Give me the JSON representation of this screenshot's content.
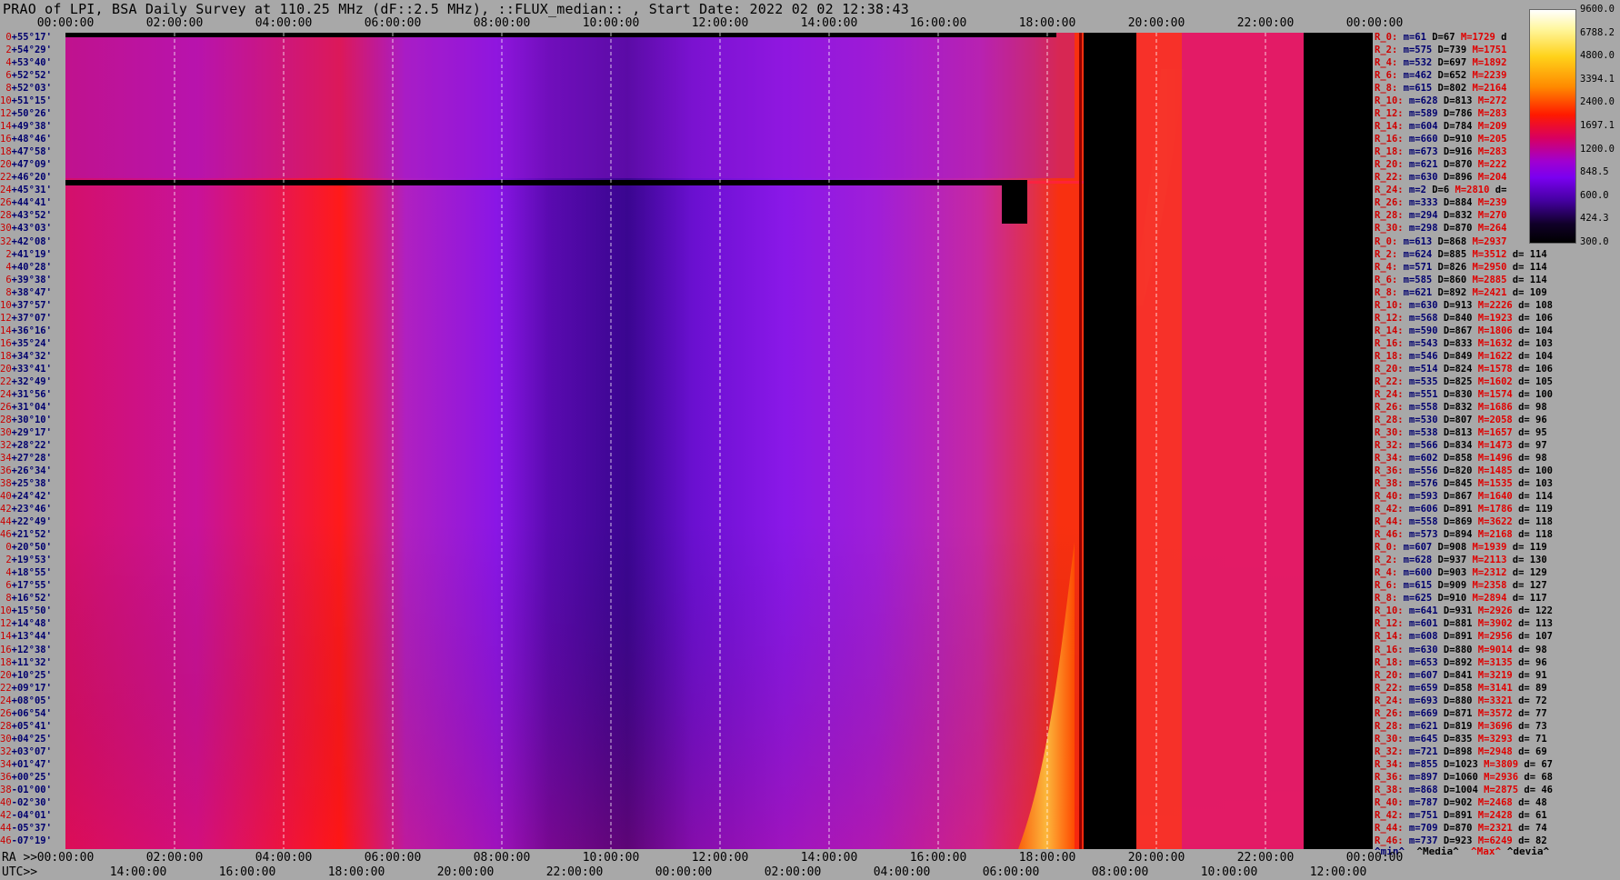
{
  "title": "PRAO of LPI, BSA Daily Survey at 110.25 MHz (dF::2.5 MHz), ::FLUX_median:: , Start Date: 2022 02 02 12:38:43",
  "top_axis_label": "",
  "bottom_axis": {
    "ra_label": "RA >>",
    "utc_label": "UTC>>",
    "ra_ticks": [
      "00:00:00",
      "02:00:00",
      "04:00:00",
      "06:00:00",
      "08:00:00",
      "10:00:00",
      "12:00:00",
      "14:00:00",
      "16:00:00",
      "18:00:00",
      "20:00:00",
      "22:00:00",
      "00:00:00"
    ],
    "utc_ticks": [
      "14:00:00",
      "16:00:00",
      "18:00:00",
      "20:00:00",
      "22:00:00",
      "00:00:00",
      "02:00:00",
      "04:00:00",
      "06:00:00",
      "08:00:00",
      "10:00:00",
      "12:00:00"
    ]
  },
  "colorbar": {
    "labels": [
      "9600.0",
      "6788.2",
      "4800.0",
      "3394.1",
      "2400.0",
      "1697.1",
      "1200.0",
      "848.5",
      "600.0",
      "424.3",
      "300.0"
    ]
  },
  "stats_legend": {
    "min": "^min^",
    "median": "^Media^",
    "max": "^Max^",
    "devia": "^devia^"
  },
  "chart_data": {
    "type": "heatmap",
    "title": "PRAO of LPI, BSA Daily Survey at 110.25 MHz (dF::2.5 MHz), ::FLUX_median:: , Start Date: 2022 02 02 12:38:43",
    "x_ticks_top": [
      "00:00:00",
      "02:00:00",
      "04:00:00",
      "06:00:00",
      "08:00:00",
      "10:00:00",
      "12:00:00",
      "14:00:00",
      "16:00:00",
      "18:00:00",
      "20:00:00",
      "22:00:00",
      "00:00:00"
    ],
    "xlim_hours": [
      0,
      24
    ],
    "colorbar_range": [
      300,
      9600
    ],
    "colorbar_scale": "log",
    "dec_rows": [
      {
        "n": "0",
        "dec": "+55°17'"
      },
      {
        "n": "2",
        "dec": "+54°29'"
      },
      {
        "n": "4",
        "dec": "+53°40'"
      },
      {
        "n": "6",
        "dec": "+52°52'"
      },
      {
        "n": "8",
        "dec": "+52°03'"
      },
      {
        "n": "10",
        "dec": "+51°15'"
      },
      {
        "n": "12",
        "dec": "+50°26'"
      },
      {
        "n": "14",
        "dec": "+49°38'"
      },
      {
        "n": "16",
        "dec": "+48°46'"
      },
      {
        "n": "18",
        "dec": "+47°58'"
      },
      {
        "n": "20",
        "dec": "+47°09'"
      },
      {
        "n": "22",
        "dec": "+46°20'"
      },
      {
        "n": "24",
        "dec": "+45°31'"
      },
      {
        "n": "26",
        "dec": "+44°41'"
      },
      {
        "n": "28",
        "dec": "+43°52'"
      },
      {
        "n": "30",
        "dec": "+43°03'"
      },
      {
        "n": "32",
        "dec": "+42°08'"
      },
      {
        "n": "2",
        "dec": "+41°19'"
      },
      {
        "n": "4",
        "dec": "+40°28'"
      },
      {
        "n": "6",
        "dec": "+39°38'"
      },
      {
        "n": "8",
        "dec": "+38°47'"
      },
      {
        "n": "10",
        "dec": "+37°57'"
      },
      {
        "n": "12",
        "dec": "+37°07'"
      },
      {
        "n": "14",
        "dec": "+36°16'"
      },
      {
        "n": "16",
        "dec": "+35°24'"
      },
      {
        "n": "18",
        "dec": "+34°32'"
      },
      {
        "n": "20",
        "dec": "+33°41'"
      },
      {
        "n": "22",
        "dec": "+32°49'"
      },
      {
        "n": "24",
        "dec": "+31°56'"
      },
      {
        "n": "26",
        "dec": "+31°04'"
      },
      {
        "n": "28",
        "dec": "+30°10'"
      },
      {
        "n": "30",
        "dec": "+29°17'"
      },
      {
        "n": "32",
        "dec": "+28°22'"
      },
      {
        "n": "34",
        "dec": "+27°28'"
      },
      {
        "n": "36",
        "dec": "+26°34'"
      },
      {
        "n": "38",
        "dec": "+25°38'"
      },
      {
        "n": "40",
        "dec": "+24°42'"
      },
      {
        "n": "42",
        "dec": "+23°46'"
      },
      {
        "n": "44",
        "dec": "+22°49'"
      },
      {
        "n": "46",
        "dec": "+21°52'"
      },
      {
        "n": "0",
        "dec": "+20°50'"
      },
      {
        "n": "2",
        "dec": "+19°53'"
      },
      {
        "n": "4",
        "dec": "+18°55'"
      },
      {
        "n": "6",
        "dec": "+17°55'"
      },
      {
        "n": "8",
        "dec": "+16°52'"
      },
      {
        "n": "10",
        "dec": "+15°50'"
      },
      {
        "n": "12",
        "dec": "+14°48'"
      },
      {
        "n": "14",
        "dec": "+13°44'"
      },
      {
        "n": "16",
        "dec": "+12°38'"
      },
      {
        "n": "18",
        "dec": "+11°32'"
      },
      {
        "n": "20",
        "dec": "+10°25'"
      },
      {
        "n": "22",
        "dec": "+09°17'"
      },
      {
        "n": "24",
        "dec": "+08°05'"
      },
      {
        "n": "26",
        "dec": "+06°54'"
      },
      {
        "n": "28",
        "dec": "+05°41'"
      },
      {
        "n": "30",
        "dec": "+04°25'"
      },
      {
        "n": "32",
        "dec": "+03°07'"
      },
      {
        "n": "34",
        "dec": "+01°47'"
      },
      {
        "n": "36",
        "dec": "+00°25'"
      },
      {
        "n": "38",
        "dec": "-01°00'"
      },
      {
        "n": "40",
        "dec": "-02°30'"
      },
      {
        "n": "42",
        "dec": "-04°01'"
      },
      {
        "n": "44",
        "dec": "-05°37'"
      },
      {
        "n": "46",
        "dec": "-07°19'"
      }
    ],
    "stats_rows": [
      {
        "r": "R_0:",
        "min": "m=61",
        "med": "D=67",
        "max": "M=1729",
        "dev": "d"
      },
      {
        "r": "R_2:",
        "min": "m=575",
        "med": "D=739",
        "max": "M=1751",
        "dev": ""
      },
      {
        "r": "R_4:",
        "min": "m=532",
        "med": "D=697",
        "max": "M=1892",
        "dev": ""
      },
      {
        "r": "R_6:",
        "min": "m=462",
        "med": "D=652",
        "max": "M=2239",
        "dev": ""
      },
      {
        "r": "R_8:",
        "min": "m=615",
        "med": "D=802",
        "max": "M=2164",
        "dev": ""
      },
      {
        "r": "R_10:",
        "min": "m=628",
        "med": "D=813",
        "max": "M=272",
        "dev": ""
      },
      {
        "r": "R_12:",
        "min": "m=589",
        "med": "D=786",
        "max": "M=283",
        "dev": ""
      },
      {
        "r": "R_14:",
        "min": "m=604",
        "med": "D=784",
        "max": "M=209",
        "dev": ""
      },
      {
        "r": "R_16:",
        "min": "m=660",
        "med": "D=910",
        "max": "M=205",
        "dev": ""
      },
      {
        "r": "R_18:",
        "min": "m=673",
        "med": "D=916",
        "max": "M=283",
        "dev": ""
      },
      {
        "r": "R_20:",
        "min": "m=621",
        "med": "D=870",
        "max": "M=222",
        "dev": ""
      },
      {
        "r": "R_22:",
        "min": "m=630",
        "med": "D=896",
        "max": "M=204",
        "dev": ""
      },
      {
        "r": "R_24:",
        "min": "m=2",
        "med": "D=6",
        "max": "M=2810",
        "dev": "d="
      },
      {
        "r": "R_26:",
        "min": "m=333",
        "med": "D=884",
        "max": "M=239",
        "dev": ""
      },
      {
        "r": "R_28:",
        "min": "m=294",
        "med": "D=832",
        "max": "M=270",
        "dev": ""
      },
      {
        "r": "R_30:",
        "min": "m=298",
        "med": "D=870",
        "max": "M=264",
        "dev": ""
      },
      {
        "r": "R_0:",
        "min": "m=613",
        "med": "D=868",
        "max": "M=2937",
        "dev": ""
      },
      {
        "r": "R_2:",
        "min": "m=624",
        "med": "D=885",
        "max": "M=3512",
        "dev": "d= 114"
      },
      {
        "r": "R_4:",
        "min": "m=571",
        "med": "D=826",
        "max": "M=2950",
        "dev": "d= 114"
      },
      {
        "r": "R_6:",
        "min": "m=585",
        "med": "D=860",
        "max": "M=2885",
        "dev": "d= 114"
      },
      {
        "r": "R_8:",
        "min": "m=621",
        "med": "D=892",
        "max": "M=2421",
        "dev": "d= 109"
      },
      {
        "r": "R_10:",
        "min": "m=630",
        "med": "D=913",
        "max": "M=2226",
        "dev": "d= 108"
      },
      {
        "r": "R_12:",
        "min": "m=568",
        "med": "D=840",
        "max": "M=1923",
        "dev": "d= 106"
      },
      {
        "r": "R_14:",
        "min": "m=590",
        "med": "D=867",
        "max": "M=1806",
        "dev": "d= 104"
      },
      {
        "r": "R_16:",
        "min": "m=543",
        "med": "D=833",
        "max": "M=1632",
        "dev": "d= 103"
      },
      {
        "r": "R_18:",
        "min": "m=546",
        "med": "D=849",
        "max": "M=1622",
        "dev": "d= 104"
      },
      {
        "r": "R_20:",
        "min": "m=514",
        "med": "D=824",
        "max": "M=1578",
        "dev": "d= 106"
      },
      {
        "r": "R_22:",
        "min": "m=535",
        "med": "D=825",
        "max": "M=1602",
        "dev": "d= 105"
      },
      {
        "r": "R_24:",
        "min": "m=551",
        "med": "D=830",
        "max": "M=1574",
        "dev": "d= 100"
      },
      {
        "r": "R_26:",
        "min": "m=558",
        "med": "D=832",
        "max": "M=1686",
        "dev": "d= 98"
      },
      {
        "r": "R_28:",
        "min": "m=530",
        "med": "D=807",
        "max": "M=2058",
        "dev": "d= 96"
      },
      {
        "r": "R_30:",
        "min": "m=538",
        "med": "D=813",
        "max": "M=1657",
        "dev": "d= 95"
      },
      {
        "r": "R_32:",
        "min": "m=566",
        "med": "D=834",
        "max": "M=1473",
        "dev": "d= 97"
      },
      {
        "r": "R_34:",
        "min": "m=602",
        "med": "D=858",
        "max": "M=1496",
        "dev": "d= 98"
      },
      {
        "r": "R_36:",
        "min": "m=556",
        "med": "D=820",
        "max": "M=1485",
        "dev": "d= 100"
      },
      {
        "r": "R_38:",
        "min": "m=576",
        "med": "D=845",
        "max": "M=1535",
        "dev": "d= 103"
      },
      {
        "r": "R_40:",
        "min": "m=593",
        "med": "D=867",
        "max": "M=1640",
        "dev": "d= 114"
      },
      {
        "r": "R_42:",
        "min": "m=606",
        "med": "D=891",
        "max": "M=1786",
        "dev": "d= 119"
      },
      {
        "r": "R_44:",
        "min": "m=558",
        "med": "D=869",
        "max": "M=3622",
        "dev": "d= 118"
      },
      {
        "r": "R_46:",
        "min": "m=573",
        "med": "D=894",
        "max": "M=2168",
        "dev": "d= 118"
      },
      {
        "r": "R_0:",
        "min": "m=607",
        "med": "D=908",
        "max": "M=1939",
        "dev": "d= 119"
      },
      {
        "r": "R_2:",
        "min": "m=628",
        "med": "D=937",
        "max": "M=2113",
        "dev": "d= 130"
      },
      {
        "r": "R_4:",
        "min": "m=600",
        "med": "D=903",
        "max": "M=2312",
        "dev": "d= 129"
      },
      {
        "r": "R_6:",
        "min": "m=615",
        "med": "D=909",
        "max": "M=2358",
        "dev": "d= 127"
      },
      {
        "r": "R_8:",
        "min": "m=625",
        "med": "D=910",
        "max": "M=2894",
        "dev": "d= 117"
      },
      {
        "r": "R_10:",
        "min": "m=641",
        "med": "D=931",
        "max": "M=2926",
        "dev": "d= 122"
      },
      {
        "r": "R_12:",
        "min": "m=601",
        "med": "D=881",
        "max": "M=3902",
        "dev": "d= 113"
      },
      {
        "r": "R_14:",
        "min": "m=608",
        "med": "D=891",
        "max": "M=2956",
        "dev": "d= 107"
      },
      {
        "r": "R_16:",
        "min": "m=630",
        "med": "D=880",
        "max": "M=9014",
        "dev": "d= 98"
      },
      {
        "r": "R_18:",
        "min": "m=653",
        "med": "D=892",
        "max": "M=3135",
        "dev": "d= 96"
      },
      {
        "r": "R_20:",
        "min": "m=607",
        "med": "D=841",
        "max": "M=3219",
        "dev": "d= 91"
      },
      {
        "r": "R_22:",
        "min": "m=659",
        "med": "D=858",
        "max": "M=3141",
        "dev": "d= 89"
      },
      {
        "r": "R_24:",
        "min": "m=693",
        "med": "D=880",
        "max": "M=3321",
        "dev": "d= 72"
      },
      {
        "r": "R_26:",
        "min": "m=669",
        "med": "D=871",
        "max": "M=3572",
        "dev": "d= 77"
      },
      {
        "r": "R_28:",
        "min": "m=621",
        "med": "D=819",
        "max": "M=3696",
        "dev": "d= 73"
      },
      {
        "r": "R_30:",
        "min": "m=645",
        "med": "D=835",
        "max": "M=3293",
        "dev": "d= 71"
      },
      {
        "r": "R_32:",
        "min": "m=721",
        "med": "D=898",
        "max": "M=2948",
        "dev": "d= 69"
      },
      {
        "r": "R_34:",
        "min": "m=855",
        "med": "D=1023",
        "max": "M=3809",
        "dev": "d= 67"
      },
      {
        "r": "R_36:",
        "min": "m=897",
        "med": "D=1060",
        "max": "M=2936",
        "dev": "d= 68"
      },
      {
        "r": "R_38:",
        "min": "m=868",
        "med": "D=1004",
        "max": "M=2875",
        "dev": "d= 46"
      },
      {
        "r": "R_40:",
        "min": "m=787",
        "med": "D=902",
        "max": "M=2468",
        "dev": "d= 48"
      },
      {
        "r": "R_42:",
        "min": "m=751",
        "med": "D=891",
        "max": "M=2428",
        "dev": "d= 61"
      },
      {
        "r": "R_44:",
        "min": "m=709",
        "med": "D=870",
        "max": "M=2321",
        "dev": "d= 74"
      },
      {
        "r": "R_46:",
        "min": "m=737",
        "med": "D=923",
        "max": "M=6249",
        "dev": "d= 82"
      }
    ]
  }
}
